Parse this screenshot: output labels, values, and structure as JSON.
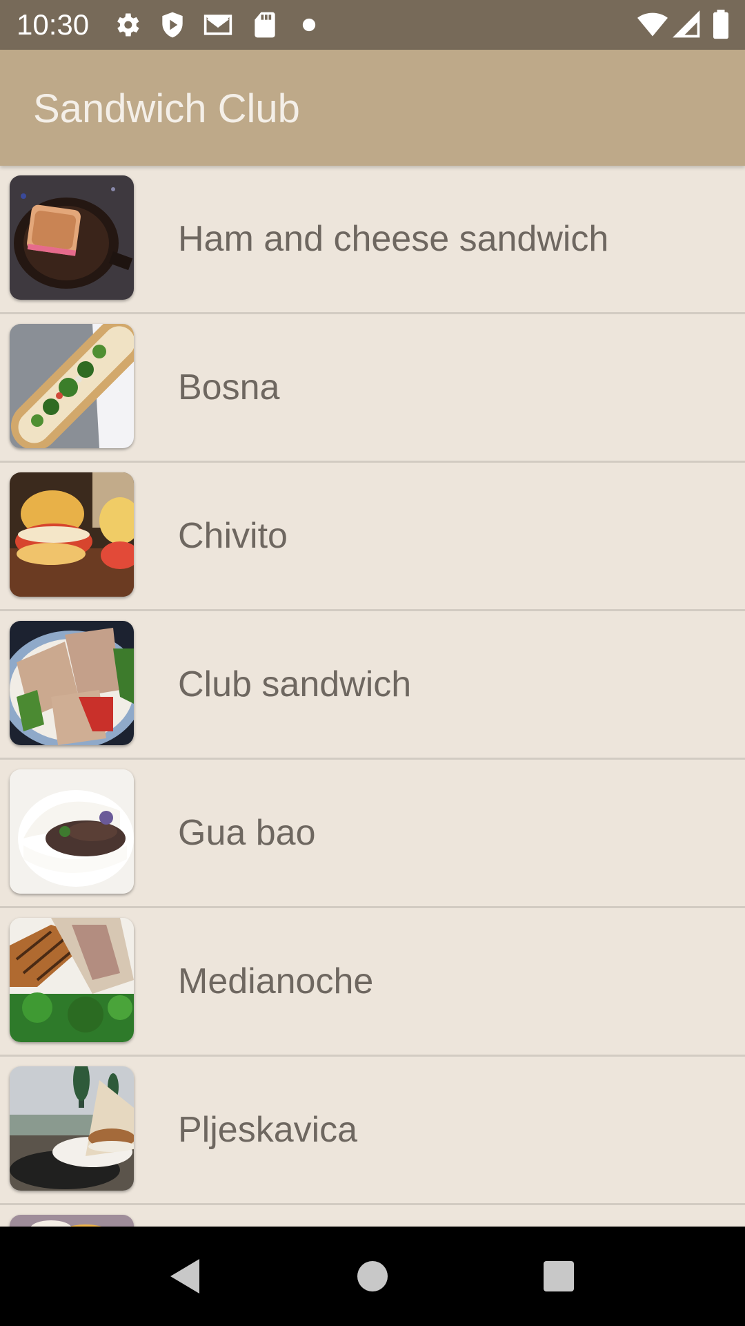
{
  "status_bar": {
    "time": "10:30",
    "left_icons": [
      "gear-icon",
      "shield-play-icon",
      "gmail-icon",
      "sd-card-icon",
      "notification-dot-icon"
    ],
    "right_icons": [
      "wifi-icon",
      "cell-signal-icon",
      "battery-icon"
    ]
  },
  "app_bar": {
    "title": "Sandwich Club",
    "color": "#bea989"
  },
  "sandwiches": [
    {
      "name": "Ham and cheese sandwich",
      "image": "ham-and-cheese-thumbnail"
    },
    {
      "name": "Bosna",
      "image": "bosna-thumbnail"
    },
    {
      "name": "Chivito",
      "image": "chivito-thumbnail"
    },
    {
      "name": "Club sandwich",
      "image": "club-sandwich-thumbnail"
    },
    {
      "name": "Gua bao",
      "image": "gua-bao-thumbnail"
    },
    {
      "name": "Medianoche",
      "image": "medianoche-thumbnail"
    },
    {
      "name": "Pljeskavica",
      "image": "pljeskavica-thumbnail"
    },
    {
      "name": "",
      "image": "partial-thumbnail"
    }
  ],
  "nav_bar": {
    "buttons": [
      "back-icon",
      "home-icon",
      "recents-icon"
    ]
  },
  "colors": {
    "status_bar": "#776a59",
    "background": "#ede5db",
    "divider": "#d2cbc2",
    "label_text": "#6e6760"
  }
}
